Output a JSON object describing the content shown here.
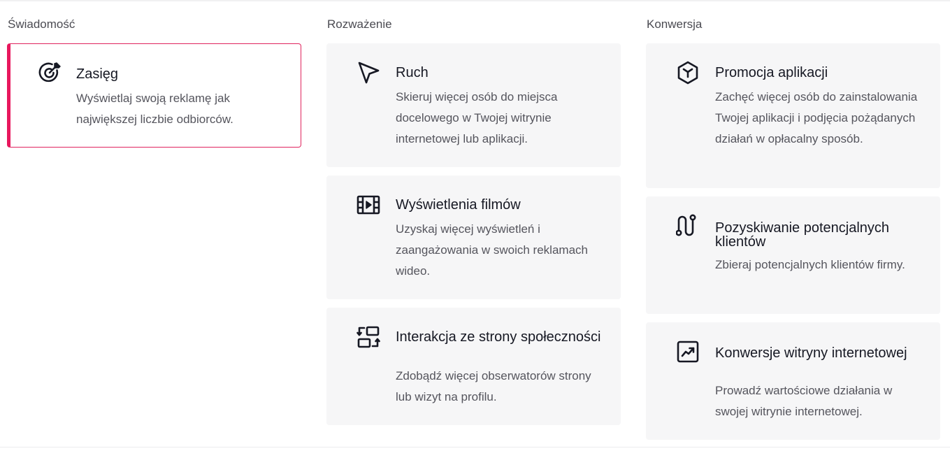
{
  "columns": [
    {
      "title": "Świadomość",
      "cards": [
        {
          "title": "Zasięg",
          "description": "Wyświetlaj swoją reklamę jak największej liczbie odbiorców.",
          "icon": "target-icon",
          "selected": true
        }
      ]
    },
    {
      "title": "Rozważenie",
      "cards": [
        {
          "title": "Ruch",
          "description": "Skieruj więcej osób do miejsca docelowego w Twojej witrynie internetowej lub aplikacji.",
          "icon": "cursor-arrow-icon",
          "selected": false
        },
        {
          "title": "Wyświetlenia filmów",
          "description": "Uzyskaj więcej wyświetleń i zaangażowania w swoich reklamach wideo.",
          "icon": "film-play-icon",
          "selected": false
        },
        {
          "title": "Interakcja ze strony społeczności",
          "description": "Zdobądź więcej obserwatorów strony lub wizyt na profilu.",
          "icon": "profile-exchange-icon",
          "selected": false
        }
      ]
    },
    {
      "title": "Konwersja",
      "cards": [
        {
          "title": "Promocja aplikacji",
          "description": "Zachęć więcej osób do zainstalowania Twojej aplikacji i podjęcia pożądanych działań w opłacalny sposób.",
          "icon": "app-cube-icon",
          "selected": false
        },
        {
          "title": "Pozyskiwanie potencjalnych klientów",
          "description": "Zbieraj potencjalnych klientów firmy.",
          "icon": "lead-funnel-icon",
          "selected": false
        },
        {
          "title": "Konwersje witryny internetowej",
          "description": "Prowadź wartościowe działania w swojej witrynie internetowej.",
          "icon": "trend-chart-icon",
          "selected": false
        }
      ]
    }
  ],
  "colors": {
    "accent": "#e8175d",
    "card_bg": "#f6f6f7",
    "title_text": "#161823",
    "body_text": "#55555d"
  }
}
